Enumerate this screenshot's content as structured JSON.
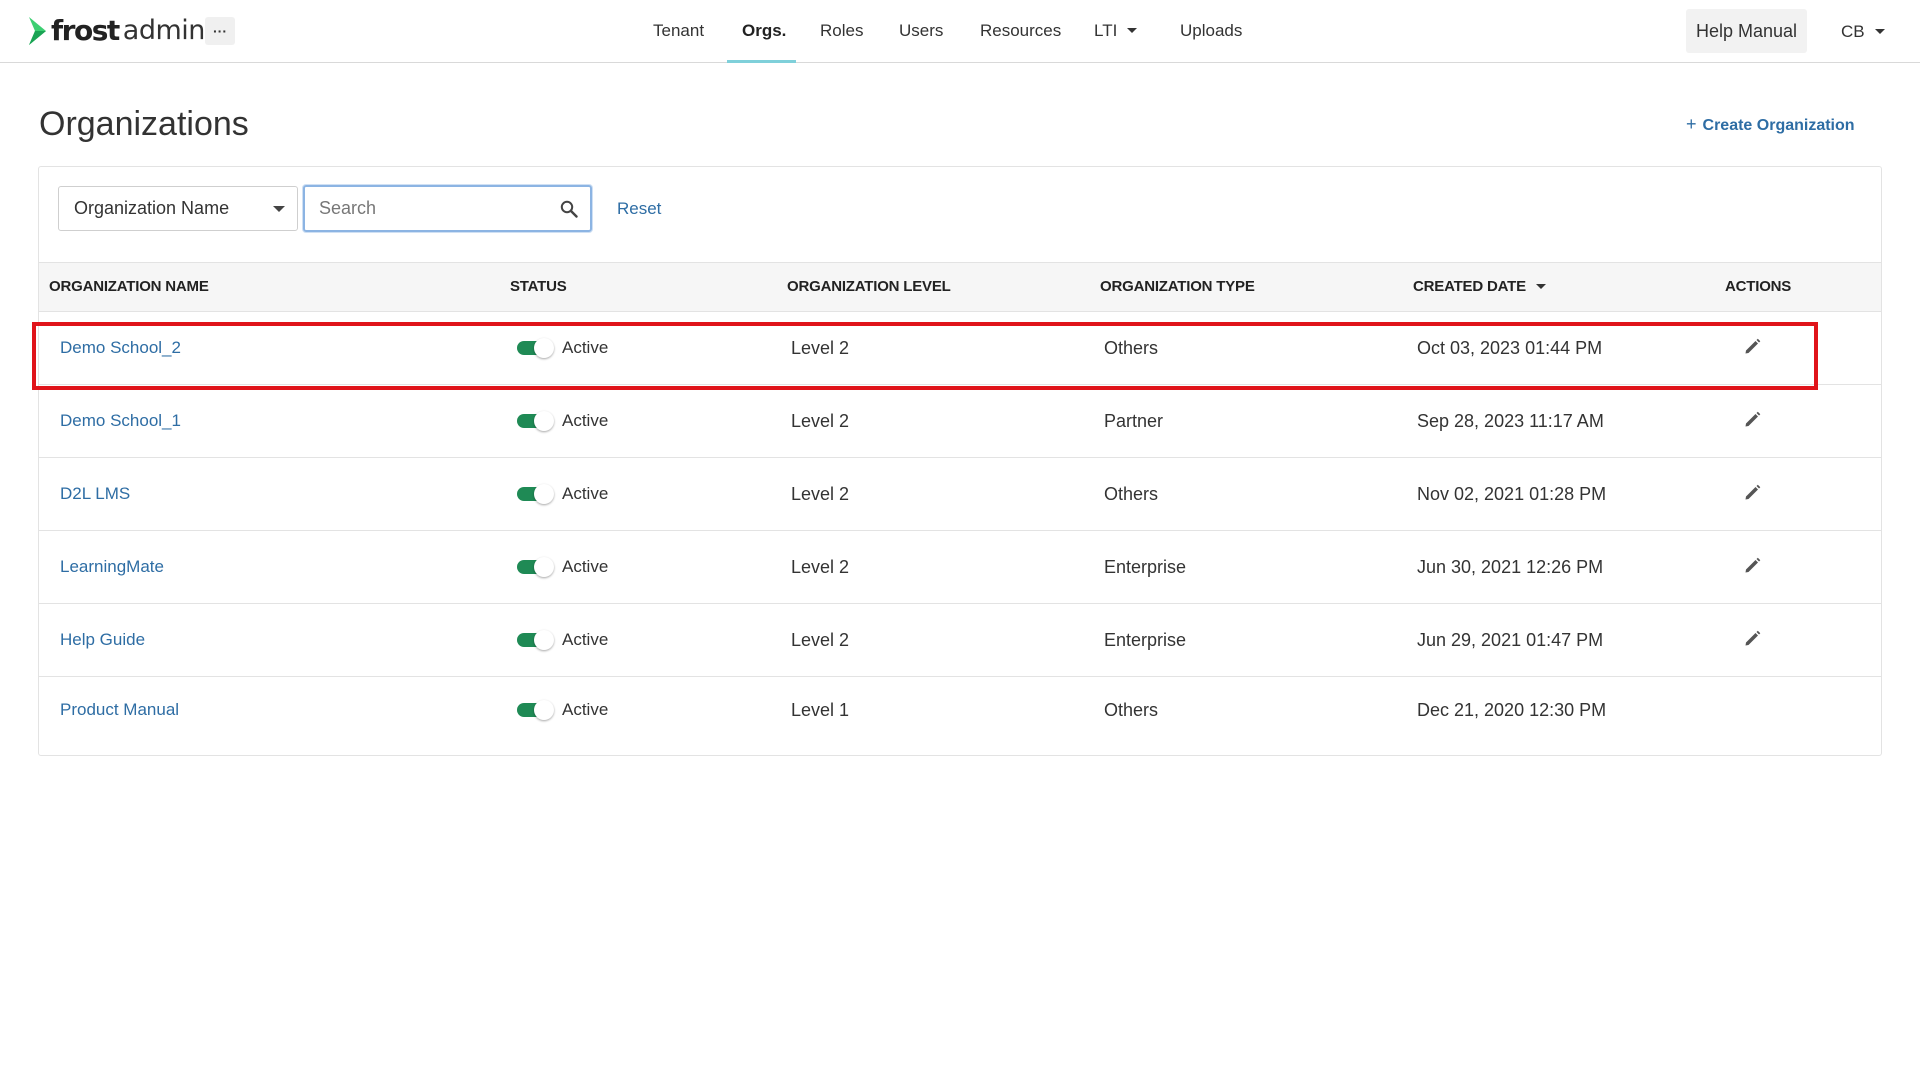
{
  "app": {
    "logo_frost": "frost",
    "logo_admin": "admin",
    "more_label": "···",
    "brand_color": "#3dcf72"
  },
  "nav": {
    "items": [
      {
        "label": "Tenant",
        "active": false
      },
      {
        "label": "Orgs.",
        "active": true
      },
      {
        "label": "Roles",
        "active": false
      },
      {
        "label": "Users",
        "active": false
      },
      {
        "label": "Resources",
        "active": false
      },
      {
        "label": "LTI",
        "active": false,
        "dropdown": true
      },
      {
        "label": "Uploads",
        "active": false
      }
    ],
    "help_label": "Help Manual",
    "user_initials": "CB"
  },
  "page": {
    "title": "Organizations",
    "create_label": "Create Organization",
    "create_icon": "plus-icon"
  },
  "filters": {
    "field_selected": "Organization Name",
    "search_placeholder": "Search",
    "search_value": "",
    "search_icon": "search-icon",
    "reset_label": "Reset"
  },
  "table": {
    "columns": [
      "ORGANIZATION NAME",
      "STATUS",
      "ORGANIZATION LEVEL",
      "ORGANIZATION TYPE",
      "CREATED DATE",
      "ACTIONS"
    ],
    "sorted_column": "CREATED DATE",
    "rows": [
      {
        "name": "Demo School_2",
        "status": "Active",
        "level": "Level 2",
        "type": "Others",
        "created": "Oct 03, 2023 01:44 PM",
        "editable": true,
        "highlighted": true
      },
      {
        "name": "Demo School_1",
        "status": "Active",
        "level": "Level 2",
        "type": "Partner",
        "created": "Sep 28, 2023 11:17 AM",
        "editable": true,
        "highlighted": false
      },
      {
        "name": "D2L LMS",
        "status": "Active",
        "level": "Level 2",
        "type": "Others",
        "created": "Nov 02, 2021 01:28 PM",
        "editable": true,
        "highlighted": false
      },
      {
        "name": "LearningMate",
        "status": "Active",
        "level": "Level 2",
        "type": "Enterprise",
        "created": "Jun 30, 2021 12:26 PM",
        "editable": true,
        "highlighted": false
      },
      {
        "name": "Help Guide",
        "status": "Active",
        "level": "Level 2",
        "type": "Enterprise",
        "created": "Jun 29, 2021 01:47 PM",
        "editable": true,
        "highlighted": false
      },
      {
        "name": "Product Manual",
        "status": "Active",
        "level": "Level 1",
        "type": "Others",
        "created": "Dec 21, 2020 12:30 PM",
        "editable": false,
        "highlighted": false
      }
    ]
  },
  "colors": {
    "link": "#2e6da4",
    "toggle_on": "#1f8a55",
    "highlight": "#e0141a",
    "nav_underline": "#7fd0da"
  }
}
